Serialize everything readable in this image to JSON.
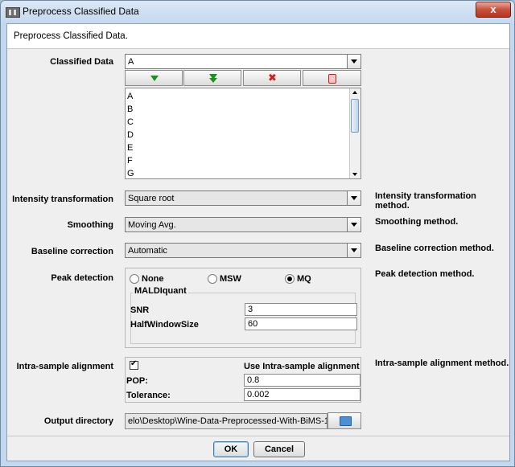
{
  "window": {
    "title": "Preprocess Classified Data",
    "close_label": "x"
  },
  "header": {
    "text": "Preprocess Classified Data."
  },
  "classified_data": {
    "label": "Classified Data",
    "selected": "A",
    "toolbar": [
      "move-down-icon",
      "move-bottom-icon",
      "delete-icon",
      "clear-icon"
    ],
    "items": [
      "A",
      "B",
      "C",
      "D",
      "E",
      "F",
      "G"
    ]
  },
  "intensity": {
    "label": "Intensity transformation",
    "value": "Square root",
    "desc": "Intensity transformation method."
  },
  "smoothing": {
    "label": "Smoothing",
    "value": "Moving Avg.",
    "desc": "Smoothing method."
  },
  "baseline": {
    "label": "Baseline correction",
    "value": "Automatic",
    "desc": "Baseline correction method."
  },
  "peak": {
    "label": "Peak detection",
    "desc": "Peak detection method.",
    "options": [
      "None",
      "MSW",
      "MQ"
    ],
    "selected": "MQ",
    "group_title": "MALDIquant",
    "snr_label": "SNR",
    "snr_value": "3",
    "hws_label": "HalfWindowSize",
    "hws_value": "60"
  },
  "alignment": {
    "label": "Intra-sample alignment",
    "desc": "Intra-sample alignment method.",
    "checked": true,
    "check_label": "Use Intra-sample alignment",
    "pop_label": "POP:",
    "pop_value": "0.8",
    "tol_label": "Tolerance:",
    "tol_value": "0.002"
  },
  "output": {
    "label": "Output directory",
    "value": "elo\\Desktop\\Wine-Data-Preprocessed-With-BiMS-1"
  },
  "buttons": {
    "ok": "OK",
    "cancel": "Cancel"
  }
}
